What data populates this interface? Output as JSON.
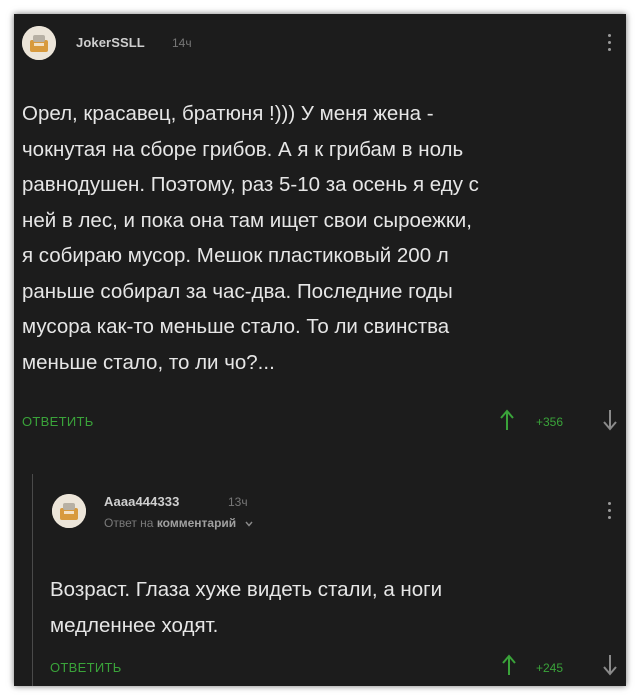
{
  "comments": [
    {
      "author": "JokerSSLL",
      "time": "14ч",
      "lines": [
        "Орел, красавец, братюня !))) У меня жена -",
        "чокнутая на сборе грибов. А я к грибам в ноль",
        "равнодушен. Поэтому, раз 5-10 за осень я еду с",
        "ней в лес, и пока она там ищет свои сыроежки,",
        "я собираю мусор. Мешок пластиковый  200 л",
        "раньше собирал за час-два. Последние годы",
        "мусора как-то меньше стало. То ли свинства",
        "меньше стало, то ли чо?..."
      ],
      "reply_label": "ОТВЕТИТЬ",
      "rating": "+356"
    },
    {
      "author": "Aaaa444333",
      "time": "13ч",
      "reply_to_prefix": "Ответ на",
      "reply_to_target": "комментарий",
      "lines": [
        "Возраст. Глаза хуже видеть стали, а ноги",
        "медленнее ходят."
      ],
      "reply_label": "ОТВЕТИТЬ",
      "rating": "+245"
    }
  ],
  "colors": {
    "background": "#1c1c1c",
    "accent": "#3aa33a",
    "text": "#e6e6e6",
    "muted": "#777777"
  },
  "icons": [
    "avatar-icon",
    "more-options-icon",
    "upvote-arrow-icon",
    "downvote-arrow-icon",
    "chevron-down-icon"
  ]
}
